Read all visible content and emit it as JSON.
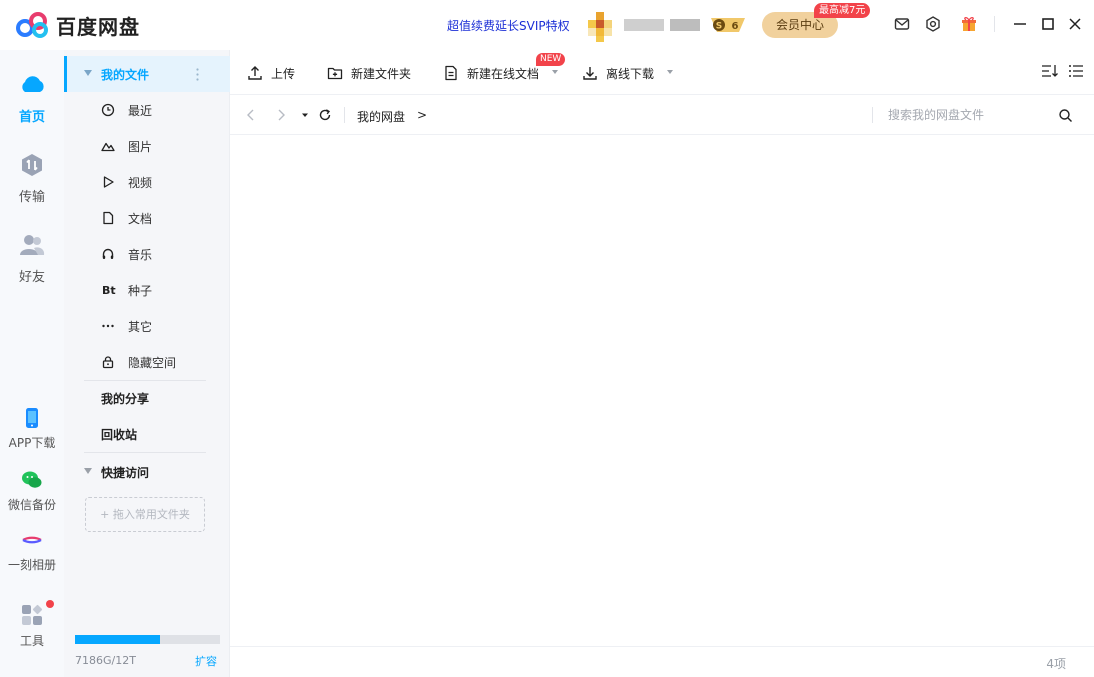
{
  "app": {
    "brand": "百度网盘"
  },
  "titlebar": {
    "promo_link": "超值续费延长SVIP特权",
    "vip_level": "6",
    "vip_center_label": "会员中心",
    "vip_center_tag": "最高减7元",
    "icons": [
      "mail-icon",
      "settings-icon",
      "gift-icon",
      "minimize-icon",
      "maximize-icon",
      "close-icon"
    ]
  },
  "rail": {
    "items": [
      {
        "label": "首页",
        "icon": "cloud-icon",
        "active": true
      },
      {
        "label": "传输",
        "icon": "transfer-icon"
      },
      {
        "label": "好友",
        "icon": "friends-icon"
      },
      {
        "label": "APP下载",
        "icon": "phone-icon"
      },
      {
        "label": "微信备份",
        "icon": "wechat-icon"
      },
      {
        "label": "一刻相册",
        "icon": "album-icon"
      },
      {
        "label": "工具",
        "icon": "tools-icon"
      }
    ]
  },
  "sidebar": {
    "my_files": "我的文件",
    "categories": [
      {
        "label": "最近",
        "icon": "clock-icon"
      },
      {
        "label": "图片",
        "icon": "picture-icon"
      },
      {
        "label": "视频",
        "icon": "play-icon"
      },
      {
        "label": "文档",
        "icon": "document-icon"
      },
      {
        "label": "音乐",
        "icon": "headphones-icon"
      },
      {
        "label": "种子",
        "icon": "bt-icon",
        "glyph": "Bt"
      },
      {
        "label": "其它",
        "icon": "more-dots-icon"
      },
      {
        "label": "隐藏空间",
        "icon": "lock-icon"
      }
    ],
    "my_share": "我的分享",
    "recycle_bin": "回收站",
    "quick_access": "快捷访问",
    "dropzone_hint": "+ 拖入常用文件夹",
    "quota_text": "7186G/12T",
    "quota_fraction": 0.585,
    "expand_label": "扩容"
  },
  "toolbar": {
    "upload": "上传",
    "new_folder": "新建文件夹",
    "new_online_doc": "新建在线文档",
    "new_tag": "NEW",
    "offline_download": "离线下载"
  },
  "addressbar": {
    "crumb": "我的网盘",
    "crumb_arrow": ">",
    "search_placeholder": "搜索我的网盘文件"
  },
  "status": {
    "count": "4项"
  },
  "colors": {
    "accent": "#06a7ff",
    "promo": "#1c2fd6",
    "vip_gold": "#f1d19d",
    "badge_red": "#f2434a"
  }
}
